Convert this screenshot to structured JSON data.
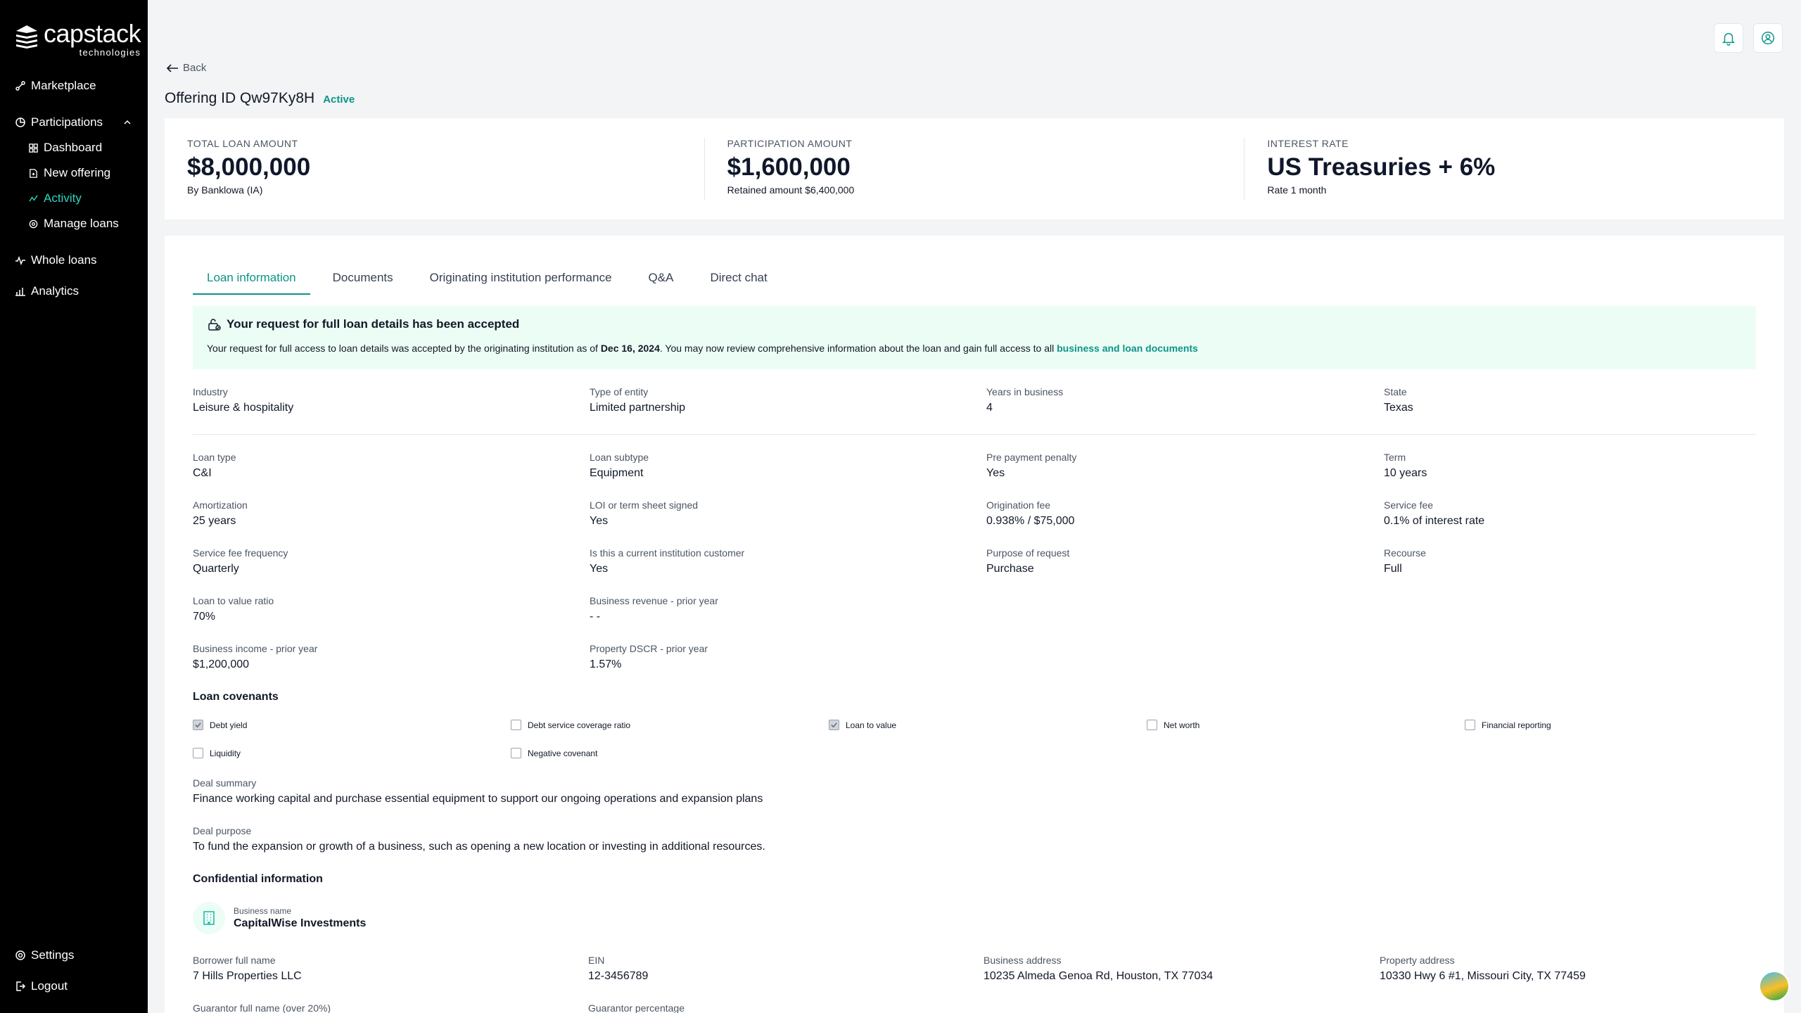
{
  "brand": {
    "name": "capstack",
    "sub": "technologies"
  },
  "nav": {
    "marketplace": "Marketplace",
    "participations": "Participations",
    "dashboard": "Dashboard",
    "new_offering": "New offering",
    "activity": "Activity",
    "manage_loans": "Manage loans",
    "whole_loans": "Whole loans",
    "analytics": "Analytics",
    "settings": "Settings",
    "logout": "Logout"
  },
  "header": {
    "back": "Back",
    "title": "Offering ID Qw97Ky8H",
    "status": "Active"
  },
  "summary": {
    "total": {
      "label": "TOTAL LOAN AMOUNT",
      "value": "$8,000,000",
      "sub": "By Banklowa (IA)"
    },
    "participation": {
      "label": "PARTICIPATION AMOUNT",
      "value": "$1,600,000",
      "sub": "Retained amount $6,400,000"
    },
    "interest": {
      "label": "INTEREST RATE",
      "value": "US Treasuries + 6%",
      "sub": "Rate 1 month"
    }
  },
  "tabs": [
    "Loan information",
    "Documents",
    "Originating institution performance",
    "Q&A",
    "Direct chat"
  ],
  "alert": {
    "title": "Your request for full loan details has been accepted",
    "body_pre": "Your request for full access to loan details was accepted by the originating institution as of ",
    "date": "Dec 16, 2024",
    "body_mid": ". You may now review comprehensive information about the loan and gain full access to all ",
    "link": "business and loan documents"
  },
  "profile": [
    {
      "label": "Industry",
      "value": "Leisure & hospitality"
    },
    {
      "label": "Type of entity",
      "value": "Limited partnership"
    },
    {
      "label": "Years in business",
      "value": "4"
    },
    {
      "label": "State",
      "value": "Texas"
    }
  ],
  "loan": [
    {
      "label": "Loan type",
      "value": "C&I"
    },
    {
      "label": "Loan subtype",
      "value": "Equipment"
    },
    {
      "label": "Pre payment penalty",
      "value": "Yes"
    },
    {
      "label": "Term",
      "value": "10 years"
    },
    {
      "label": "Amortization",
      "value": "25 years"
    },
    {
      "label": "LOI or term sheet signed",
      "value": "Yes"
    },
    {
      "label": "Origination fee",
      "value": "0.938% / $75,000"
    },
    {
      "label": "Service fee",
      "value": "0.1% of interest rate"
    },
    {
      "label": "Service fee frequency",
      "value": "Quarterly"
    },
    {
      "label": "Is this a current institution customer",
      "value": "Yes"
    },
    {
      "label": "Purpose of request",
      "value": "Purchase"
    },
    {
      "label": "Recourse",
      "value": "Full"
    },
    {
      "label": "Loan to value ratio",
      "value": "70%"
    },
    {
      "label": "Business revenue - prior year",
      "value": "- -"
    },
    {
      "label": "Business income - prior year",
      "value": "$1,200,000"
    },
    {
      "label": "Property DSCR - prior year",
      "value": "1.57%"
    }
  ],
  "covenants": {
    "title": "Loan covenants",
    "items": [
      {
        "label": "Debt yield",
        "checked": true
      },
      {
        "label": "Debt service coverage ratio",
        "checked": false
      },
      {
        "label": "Loan to value",
        "checked": true
      },
      {
        "label": "Net worth",
        "checked": false
      },
      {
        "label": "Financial reporting",
        "checked": false
      },
      {
        "label": "Liquidity",
        "checked": false
      },
      {
        "label": "Negative covenant",
        "checked": false
      }
    ]
  },
  "deal": {
    "summary_label": "Deal summary",
    "summary": "Finance working capital and purchase essential equipment to support our ongoing operations and expansion plans",
    "purpose_label": "Deal purpose",
    "purpose": "To fund the expansion or growth of a business, such as opening a new location or investing in additional resources."
  },
  "confidential": {
    "title": "Confidential information",
    "business_label": "Business name",
    "business_name": "CapitalWise Investments",
    "fields": [
      {
        "label": "Borrower full name",
        "value": "7 Hills Properties LLC"
      },
      {
        "label": "EIN",
        "value": "12-3456789"
      },
      {
        "label": "Business address",
        "value": "10235 Almeda Genoa Rd, Houston, TX 77034"
      },
      {
        "label": "Property address",
        "value": "10330 Hwy 6 #1, Missouri City, TX 77459"
      }
    ],
    "guarantor_name_label": "Guarantor full name (over 20%)",
    "guarantor_pct_label": "Guarantor percentage"
  },
  "colors": {
    "accent": "#0d9488",
    "active_nav": "#2dd4bf",
    "alert_bg": "#ecfdf5"
  }
}
